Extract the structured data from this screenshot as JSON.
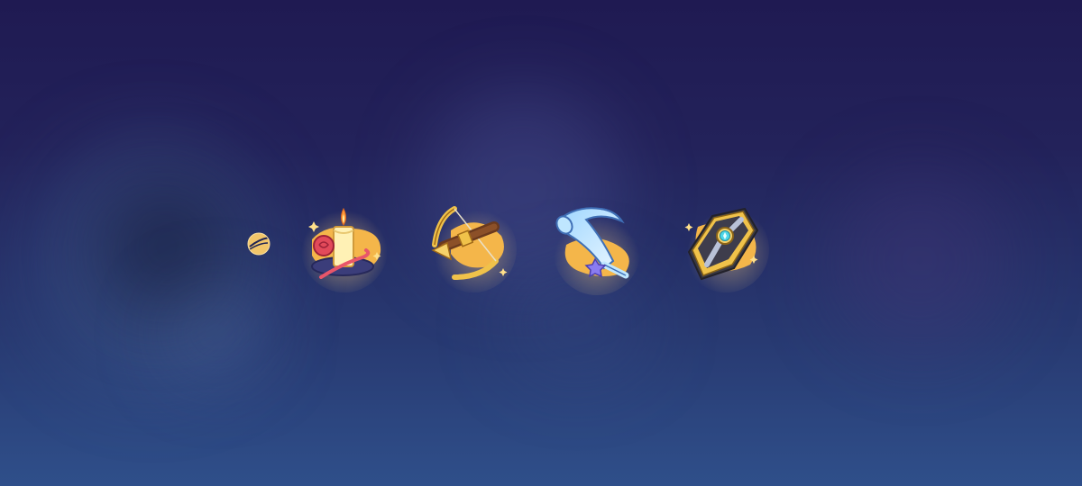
{
  "scene": {
    "background_top": "#1f1a52",
    "background_bottom": "#2f4f8a",
    "glow_color": "#f6b54a"
  },
  "path": {
    "icon": "erudition-path-icon",
    "color": "#f2c66a"
  },
  "relics": [
    {
      "icon": "candle-rose-icon"
    },
    {
      "icon": "crossbow-icon"
    },
    {
      "icon": "horn-icon"
    },
    {
      "icon": "badge-plate-icon"
    }
  ]
}
